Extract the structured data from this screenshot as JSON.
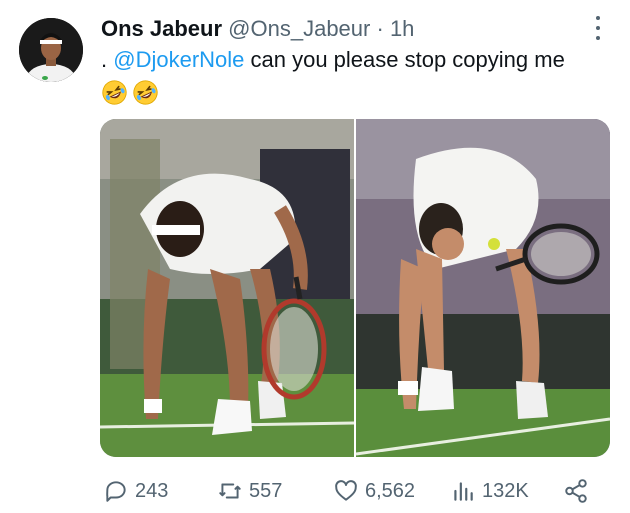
{
  "tweet": {
    "display_name": "Ons Jabeur",
    "handle": "@Ons_Jabeur",
    "separator": "·",
    "time": "1h",
    "text_prefix": ". ",
    "mention": "@DjokerNole",
    "text_suffix": " can you please stop copying me",
    "emojis": [
      "rolling-on-floor-laughing",
      "rolling-on-floor-laughing"
    ]
  },
  "media": {
    "images": [
      {
        "subject": "woman tennis player in white touching grass with racket"
      },
      {
        "subject": "man tennis player in white touching grass with racket"
      }
    ]
  },
  "actions": {
    "replies": "243",
    "reposts": "557",
    "likes": "6,562",
    "views": "132K"
  },
  "colors": {
    "text": "#0f1419",
    "secondary": "#536471",
    "link": "#1d9bf0",
    "grass": "#4f8a35"
  },
  "icons": [
    "reply-icon",
    "repost-icon",
    "like-icon",
    "views-icon",
    "share-icon",
    "more-icon"
  ]
}
